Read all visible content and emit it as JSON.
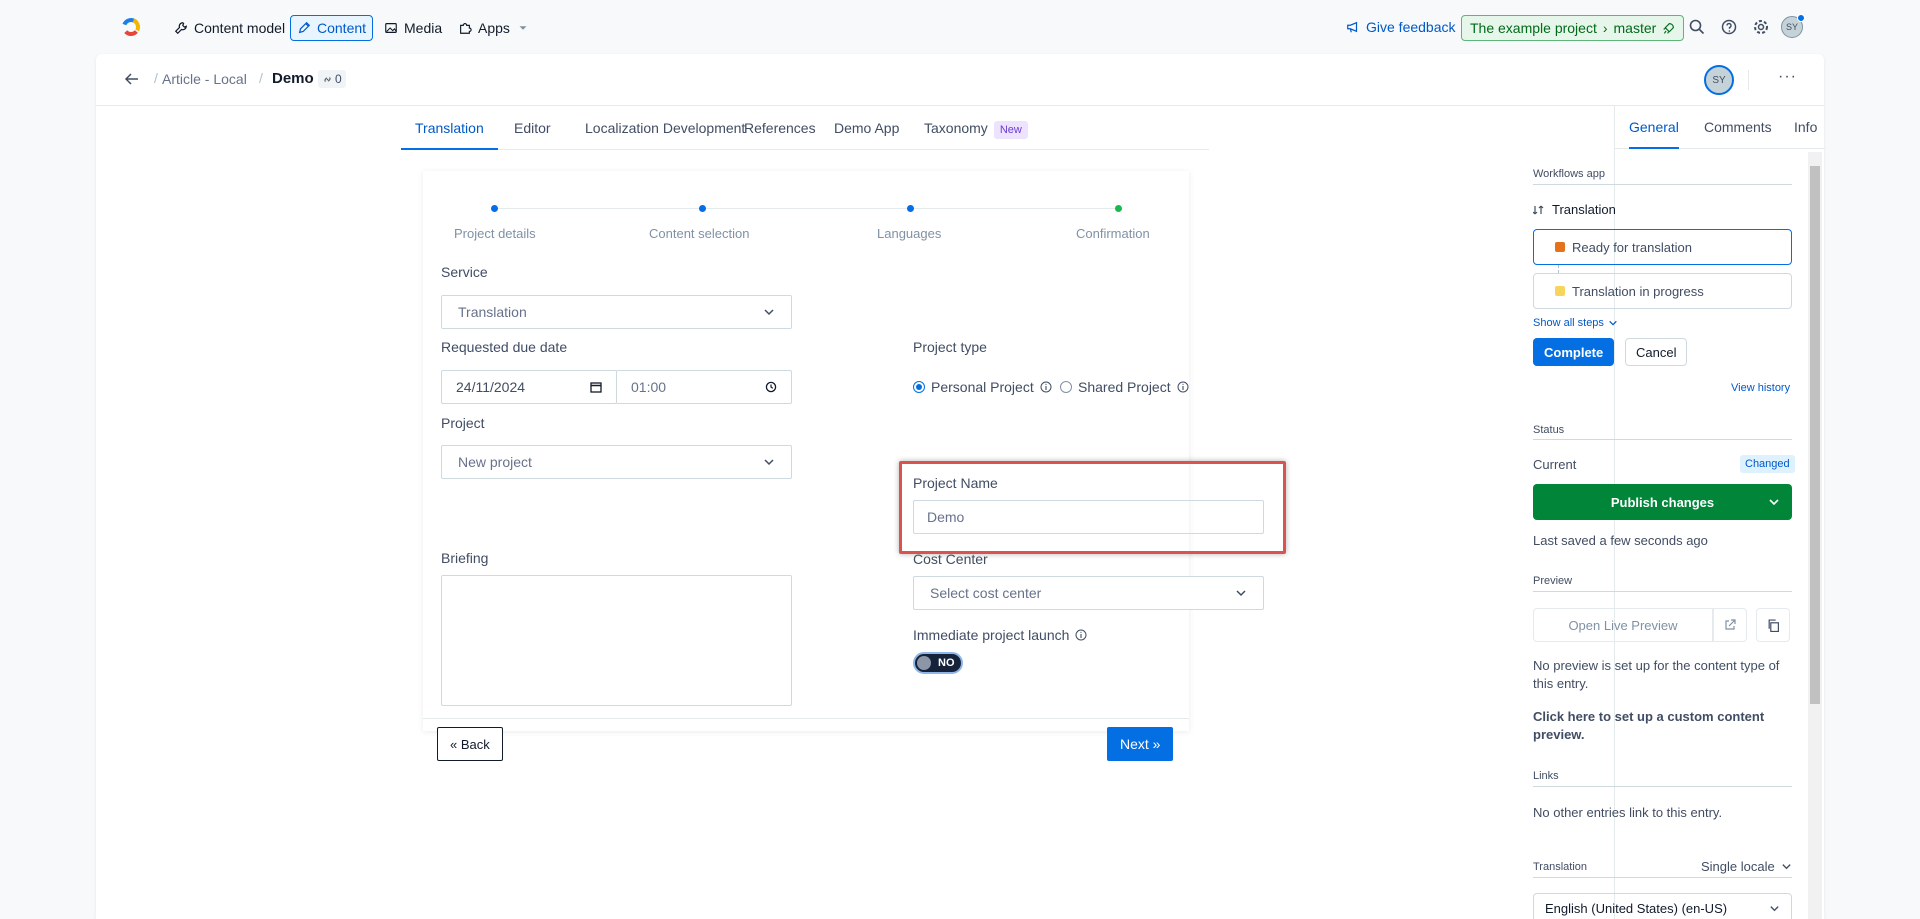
{
  "nav": {
    "items": [
      {
        "label": "Content model",
        "icon": "wrench-icon"
      },
      {
        "label": "Content",
        "icon": "pen-icon"
      },
      {
        "label": "Media",
        "icon": "image-icon"
      },
      {
        "label": "Apps",
        "icon": "puzzle-icon"
      }
    ],
    "feedback": "Give feedback",
    "env_project": "The example project",
    "env_branch": "master",
    "avatar": "SY"
  },
  "header": {
    "crumb_parent": "Article - Local",
    "crumb_current": "Demo",
    "refs_count": "0",
    "avatar": "SY",
    "more": "···"
  },
  "tabs": [
    {
      "label": "Translation",
      "active": true
    },
    {
      "label": "Editor"
    },
    {
      "label": "Localization Development"
    },
    {
      "label": "References"
    },
    {
      "label": "Demo App"
    },
    {
      "label": "Taxonomy",
      "badge": "New"
    }
  ],
  "wizard": {
    "steps": [
      {
        "label": "Project details",
        "color": "#036fe3"
      },
      {
        "label": "Content selection",
        "color": "#036fe3"
      },
      {
        "label": "Languages",
        "color": "#036fe3"
      },
      {
        "label": "Confirmation",
        "color": "#1fb54f"
      }
    ],
    "service_label": "Service",
    "service_value": "Translation",
    "due_label": "Requested due date",
    "due_date": "24/11/2024",
    "due_time": "01:00",
    "project_type_label": "Project type",
    "radio_personal": "Personal Project",
    "radio_shared": "Shared Project",
    "project_label": "Project",
    "project_value": "New project",
    "project_name_label": "Project Name",
    "project_name_value": "Demo",
    "briefing_label": "Briefing",
    "cost_center_label": "Cost Center",
    "cost_center_value": "Select cost center",
    "launch_label": "Immediate project launch",
    "toggle_text": "NO",
    "back_button": "« Back",
    "next_button": "Next »"
  },
  "sidebar": {
    "tabs": [
      "General",
      "Comments",
      "Info"
    ],
    "workflows_title": "Workflows app",
    "workflow_name": "Translation",
    "step_ready": "Ready for translation",
    "step_progress": "Translation in progress",
    "show_all": "Show all steps",
    "complete": "Complete",
    "cancel": "Cancel",
    "view_history": "View history",
    "status_title": "Status",
    "current_label": "Current",
    "changed_badge": "Changed",
    "publish": "Publish changes",
    "last_saved": "Last saved a few seconds ago",
    "preview_title": "Preview",
    "open_preview": "Open Live Preview",
    "no_preview": "No preview is set up for the content type of this entry.",
    "setup_link": "Click here to set up a custom content preview.",
    "links_title": "Links",
    "no_links": "No other entries link to this entry.",
    "translation_title": "Translation",
    "single_locale": "Single locale",
    "locale_value": "English (United States) (en-US)"
  }
}
